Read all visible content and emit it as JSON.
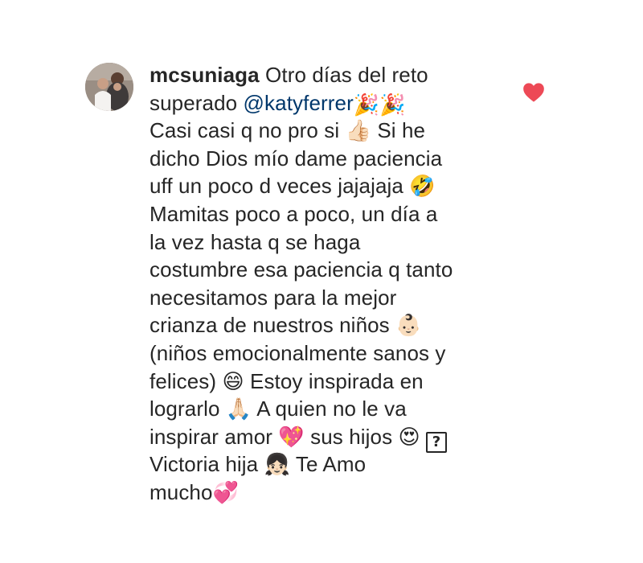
{
  "comment": {
    "username": "mcsuniaga",
    "mention": "@katyferrer",
    "liked": true,
    "like_color": "#ed4956",
    "lines": [
      {
        "before": " Otro días del reto"
      },
      {
        "before": "superado ",
        "after": " 🎉🎉"
      },
      {
        "before": "Casi casi q no pro si 👍🏻  Si he"
      },
      {
        "before": "dicho Dios mío dame paciencia"
      },
      {
        "before": "uff un poco d veces jajajaja 🤣"
      },
      {
        "before": "Mamitas poco a poco, un día a"
      },
      {
        "before": "la vez  hasta q se haga"
      },
      {
        "before": "costumbre esa paciencia q tanto"
      },
      {
        "before": "necesitamos para la mejor"
      },
      {
        "before": "crianza de nuestros niños 👶🏻"
      },
      {
        "before": "(niños emocionalmente sanos y"
      },
      {
        "before": "felices) 😄 Estoy inspirada en"
      },
      {
        "before": "lograrlo 🙏🏻  A quien no le va"
      },
      {
        "before": "inspirar amor 💖  sus hijos 😍 ",
        "box": "?"
      },
      {
        "before": "Victoria hija 👧🏻  Te Amo"
      },
      {
        "before": "mucho💞"
      }
    ]
  }
}
